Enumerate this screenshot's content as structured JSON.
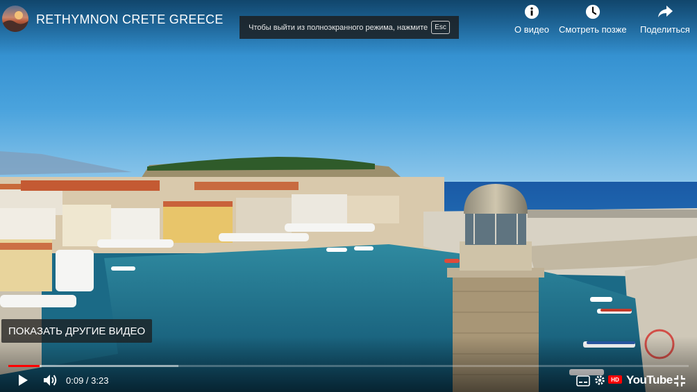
{
  "video": {
    "channel_title": "RETHYMNON CRETE GREECE",
    "fullscreen_notice": "Чтобы выйти из полноэкранного режима, нажмите",
    "fullscreen_key": "Esc"
  },
  "top_actions": [
    {
      "label": "О видео",
      "icon": "info-icon"
    },
    {
      "label": "Смотреть позже",
      "icon": "clock-icon"
    },
    {
      "label": "Поделиться",
      "icon": "share-icon"
    }
  ],
  "overlay": {
    "more_videos_label": "ПОКАЗАТЬ ДРУГИЕ ВИДЕО"
  },
  "player": {
    "current_time": "0:09",
    "separator": " / ",
    "duration": "3:23",
    "played_fraction": 0.046,
    "buffered_fraction": 0.25,
    "hd_badge": "HD",
    "brand": "YouTube",
    "accent_color": "#ff0000"
  }
}
